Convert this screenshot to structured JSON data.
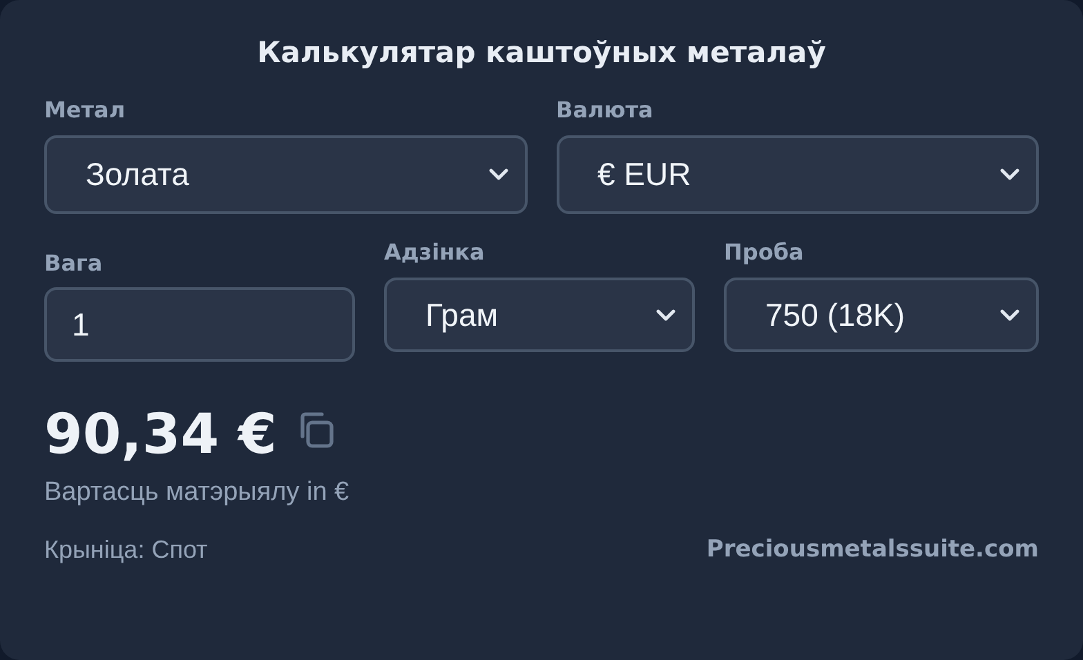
{
  "title": "Калькулятар каштоўных металаў",
  "row_1": [
    {
      "kind": "select",
      "label": "Метал",
      "value": "Золата"
    },
    {
      "kind": "select",
      "label": "Валюта",
      "value": "€ EUR"
    }
  ],
  "row_2": [
    {
      "kind": "input",
      "label": "Вага",
      "value": "1"
    },
    {
      "kind": "select",
      "label": "Адзінка",
      "value": "Грам"
    },
    {
      "kind": "select",
      "label": "Проба",
      "value": "750 (18K)"
    }
  ],
  "result": {
    "amount": "90,34 €",
    "caption": "Вартасць матэрыялу in €"
  },
  "footer": {
    "source": "Крыніца: Спот",
    "link": "Preciousmetalssuite.com"
  }
}
